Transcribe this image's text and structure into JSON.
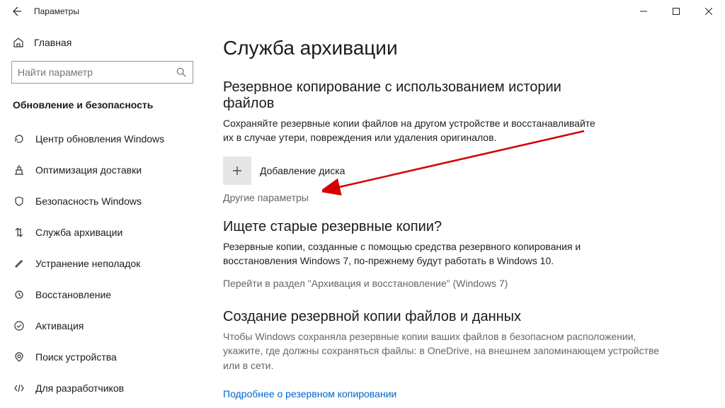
{
  "window": {
    "title": "Параметры"
  },
  "sidebar": {
    "home": "Главная",
    "search_placeholder": "Найти параметр",
    "category": "Обновление и безопасность",
    "items": [
      {
        "label": "Центр обновления Windows",
        "icon": "refresh"
      },
      {
        "label": "Оптимизация доставки",
        "icon": "delivery"
      },
      {
        "label": "Безопасность Windows",
        "icon": "shield"
      },
      {
        "label": "Служба архивации",
        "icon": "backup",
        "selected": true
      },
      {
        "label": "Устранение неполадок",
        "icon": "wrench"
      },
      {
        "label": "Восстановление",
        "icon": "recovery"
      },
      {
        "label": "Активация",
        "icon": "activation"
      },
      {
        "label": "Поиск устройства",
        "icon": "locate"
      },
      {
        "label": "Для разработчиков",
        "icon": "dev"
      }
    ]
  },
  "content": {
    "page_title": "Служба архивации",
    "section1": {
      "heading": "Резервное копирование с использованием истории файлов",
      "desc": "Сохраняйте резервные копии файлов на другом устройстве и восстанавливайте их в случае утери, повреждения или удаления оригиналов.",
      "add_disk_label": "Добавление диска",
      "more_options": "Другие параметры"
    },
    "section2": {
      "heading": "Ищете старые резервные копии?",
      "desc": "Резервные копии, созданные с помощью средства резервного копирования и восстановления Windows 7, по-прежнему будут работать в Windows 10.",
      "link": "Перейти в раздел \"Архивация и восстановление\" (Windows 7)"
    },
    "section3": {
      "heading": "Создание резервной копии файлов и данных",
      "desc": "Чтобы Windows сохраняла резервные копии ваших файлов в безопасном расположении, укажите, где должны сохраняться файлы: в OneDrive, на внешнем запоминающем устройстве или в сети.",
      "link": "Подробнее о резервном копировании"
    }
  }
}
